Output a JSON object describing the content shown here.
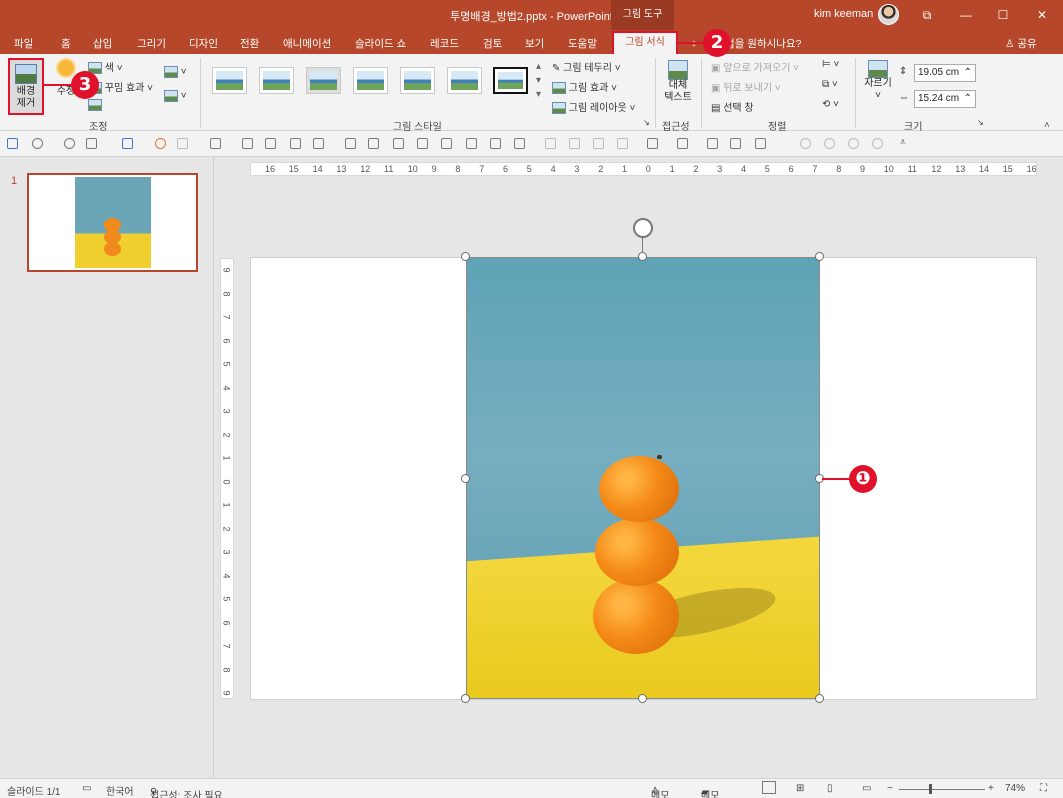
{
  "titlebar": {
    "title": "투명배경_방법2.pptx  -  PowerPoint",
    "context_label": "그림 도구",
    "user": "kim keeman",
    "controls": [
      "⧉",
      "—",
      "☐",
      "✕"
    ]
  },
  "tabs": {
    "items": [
      "파일",
      "홈",
      "삽입",
      "그리기",
      "디자인",
      "전환",
      "애니메이션",
      "슬라이드 쇼",
      "레코드",
      "검토",
      "보기",
      "도움말"
    ],
    "active_context_tab": "그림 서식",
    "tell_me": "작업을 원하시나요?",
    "share": "공유"
  },
  "ribbon": {
    "remove_bg": "배경\n제거",
    "corrections": "수정",
    "color": "색",
    "artistic": "꾸밈 효과",
    "group_adjust": "조정",
    "group_styles": "그림 스타일",
    "border": "그림 테두리",
    "effects": "그림 효과",
    "layout": "그림 레이아웃",
    "alt_text": "대체\n텍스트",
    "group_access": "접근성",
    "bring_forward": "앞으로 가져오기",
    "send_backward": "뒤로 보내기",
    "selection_pane": "선택 창",
    "group_arrange": "정렬",
    "crop": "자르기",
    "height": "19.05 cm",
    "width": "15.24 cm",
    "group_size": "크기"
  },
  "slides_pane": {
    "slide_number": "1"
  },
  "ruler": {
    "h_labels": [
      "16",
      "15",
      "14",
      "13",
      "12",
      "11",
      "10",
      "9",
      "8",
      "7",
      "6",
      "5",
      "4",
      "3",
      "2",
      "1",
      "0",
      "1",
      "2",
      "3",
      "4",
      "5",
      "6",
      "7",
      "8",
      "9",
      "10",
      "11",
      "12",
      "13",
      "14",
      "15",
      "16"
    ],
    "v_labels": [
      "9",
      "8",
      "7",
      "6",
      "5",
      "4",
      "3",
      "2",
      "1",
      "0",
      "1",
      "2",
      "3",
      "4",
      "5",
      "6",
      "7",
      "8",
      "9"
    ]
  },
  "callouts": [
    "❶",
    "2",
    "3"
  ],
  "status": {
    "slide_info": "슬라이드 1/1",
    "language": "한국어",
    "accessibility": "접근성: 조사 필요",
    "notes": "메모",
    "comments": "메모",
    "zoom": "74%"
  },
  "colors": {
    "accent": "#b7472a",
    "callout": "#e0112b"
  }
}
